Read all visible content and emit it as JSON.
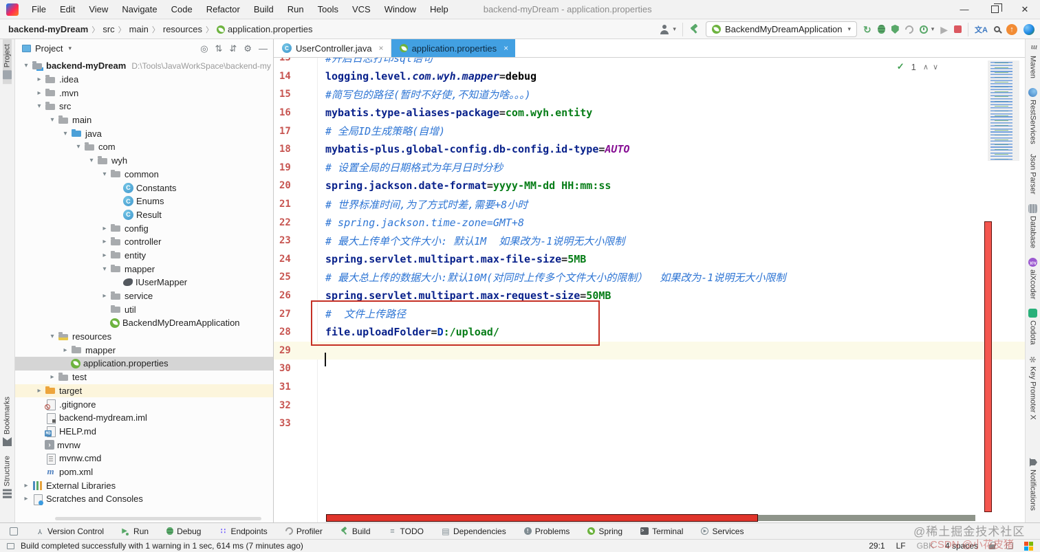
{
  "colors": {
    "accent_blue": "#42A0E2",
    "annotation_red": "#E0342B",
    "key_navy": "#08218B",
    "value_green": "#067D17",
    "comment_blue": "#2E75D4",
    "line_number_red": "#C75450",
    "spring_green": "#6DB33F"
  },
  "window": {
    "title": "backend-myDream - application.properties",
    "controls": {
      "minimize": "—",
      "close": "✕"
    }
  },
  "menu": {
    "items": [
      "File",
      "Edit",
      "View",
      "Navigate",
      "Code",
      "Refactor",
      "Build",
      "Run",
      "Tools",
      "VCS",
      "Window",
      "Help"
    ]
  },
  "toolbar": {
    "breadcrumbs": [
      {
        "t": "backend-myDream",
        "bold": true
      },
      {
        "t": "src"
      },
      {
        "t": "main"
      },
      {
        "t": "resources"
      },
      {
        "t": "application.properties",
        "icon": "spring-leaf"
      }
    ],
    "run_config": "BackendMyDreamApplication"
  },
  "left_stripe": [
    {
      "t": "Project",
      "ic": "si-project",
      "active": true,
      "pos": "top"
    },
    {
      "t": "Bookmarks",
      "ic": "si-bookmark",
      "pos": "bottom"
    },
    {
      "t": "Structure",
      "ic": "si-structure",
      "pos": "bottom"
    }
  ],
  "right_stripe": [
    {
      "t": "Maven",
      "ic": "si-maven",
      "txt": "m"
    },
    {
      "t": "RestServices",
      "ic": "si-rest"
    },
    {
      "t": "Json Parser",
      "ic": ""
    },
    {
      "t": "Database",
      "ic": "si-db"
    },
    {
      "t": "aiXcoder",
      "ic": "si-aix",
      "txt": "AiX"
    },
    {
      "t": "Codota",
      "ic": "si-codota"
    },
    {
      "t": "Key Promoter X",
      "ic": "si-kpx",
      "txt": "✻"
    },
    {
      "t": "Notifications",
      "ic": "si-bell",
      "bottom": true
    }
  ],
  "project_panel": {
    "title": "Project",
    "tree": [
      {
        "d": 0,
        "ch": "v",
        "ic": "project",
        "t": "backend-myDream",
        "bold": true,
        "sub": "D:\\Tools\\JavaWorkSpace\\backend-my"
      },
      {
        "d": 1,
        "ch": ">",
        "ic": "folder",
        "t": ".idea"
      },
      {
        "d": 1,
        "ch": ">",
        "ic": "folder",
        "t": ".mvn"
      },
      {
        "d": 1,
        "ch": "v",
        "ic": "folder",
        "t": "src"
      },
      {
        "d": 2,
        "ch": "v",
        "ic": "folder",
        "t": "main"
      },
      {
        "d": 3,
        "ch": "v",
        "ic": "folder-blue",
        "t": "java"
      },
      {
        "d": 4,
        "ch": "v",
        "ic": "package",
        "t": "com"
      },
      {
        "d": 5,
        "ch": "v",
        "ic": "package",
        "t": "wyh"
      },
      {
        "d": 6,
        "ch": "v",
        "ic": "package",
        "t": "common"
      },
      {
        "d": 7,
        "ch": "",
        "ic": "class",
        "t": "Constants"
      },
      {
        "d": 7,
        "ch": "",
        "ic": "class",
        "t": "Enums"
      },
      {
        "d": 7,
        "ch": "",
        "ic": "class",
        "t": "Result"
      },
      {
        "d": 6,
        "ch": ">",
        "ic": "package",
        "t": "config"
      },
      {
        "d": 6,
        "ch": ">",
        "ic": "package",
        "t": "controller"
      },
      {
        "d": 6,
        "ch": ">",
        "ic": "package",
        "t": "entity"
      },
      {
        "d": 6,
        "ch": "v",
        "ic": "package",
        "t": "mapper"
      },
      {
        "d": 7,
        "ch": "",
        "ic": "mybatis",
        "t": "IUserMapper"
      },
      {
        "d": 6,
        "ch": ">",
        "ic": "package",
        "t": "service"
      },
      {
        "d": 6,
        "ch": "",
        "ic": "package",
        "t": "util"
      },
      {
        "d": 6,
        "ch": "",
        "ic": "spring-class",
        "t": "BackendMyDreamApplication"
      },
      {
        "d": 2,
        "ch": "v",
        "ic": "folder-resources",
        "t": "resources"
      },
      {
        "d": 3,
        "ch": ">",
        "ic": "folder",
        "t": "mapper"
      },
      {
        "d": 3,
        "ch": "",
        "ic": "spring-file",
        "t": "application.properties",
        "sel": true
      },
      {
        "d": 2,
        "ch": ">",
        "ic": "folder",
        "t": "test"
      },
      {
        "d": 1,
        "ch": ">",
        "ic": "folder-orange",
        "t": "target",
        "hl": true
      },
      {
        "d": 1,
        "ch": "",
        "ic": "git-file",
        "t": ".gitignore"
      },
      {
        "d": 1,
        "ch": "",
        "ic": "iml-file",
        "t": "backend-mydream.iml"
      },
      {
        "d": 1,
        "ch": "",
        "ic": "md-file",
        "t": "HELP.md"
      },
      {
        "d": 1,
        "ch": "",
        "ic": "sh-file",
        "t": "mvnw"
      },
      {
        "d": 1,
        "ch": "",
        "ic": "cmd-file",
        "t": "mvnw.cmd"
      },
      {
        "d": 1,
        "ch": "",
        "ic": "maven",
        "t": "pom.xml"
      },
      {
        "d": 0,
        "ch": ">",
        "ic": "libraries",
        "t": "External Libraries"
      },
      {
        "d": 0,
        "ch": ">",
        "ic": "scratches",
        "t": "Scratches and Consoles"
      }
    ]
  },
  "editor": {
    "tabs": [
      {
        "label": "UserController.java",
        "icon": "class",
        "active": false,
        "close": "×"
      },
      {
        "label": "application.properties",
        "icon": "spring",
        "active": true,
        "close": "×"
      }
    ],
    "inspection": {
      "count": "1",
      "up": "∧",
      "down": "∨"
    },
    "cursor_line": 29,
    "lines": [
      {
        "num": 13,
        "segs": [
          {
            "t": "#开启日志打印sql语句",
            "s": "c"
          }
        ]
      },
      {
        "num": 14,
        "segs": [
          {
            "t": "logging.level",
            "s": "key"
          },
          {
            "t": ".com.wyh.mapper",
            "s": "ki"
          },
          {
            "t": "=",
            "s": "eq"
          },
          {
            "t": "debug",
            "s": "bd"
          }
        ]
      },
      {
        "num": 15,
        "segs": [
          {
            "t": "#简写包的路径(暂时不好使,不知道为啥。。。)",
            "s": "c"
          }
        ]
      },
      {
        "num": 16,
        "segs": [
          {
            "t": "mybatis.type-aliases-package",
            "s": "key"
          },
          {
            "t": "=",
            "s": "eq"
          },
          {
            "t": "com.wyh.entity",
            "s": "val"
          }
        ]
      },
      {
        "num": 17,
        "segs": [
          {
            "t": "# 全局ID生成策略(自增)",
            "s": "c"
          }
        ]
      },
      {
        "num": 18,
        "segs": [
          {
            "t": "mybatis-plus.global-config.db-config.id-type",
            "s": "key"
          },
          {
            "t": "=",
            "s": "eq"
          },
          {
            "t": "AUTO",
            "s": "pu"
          }
        ]
      },
      {
        "num": 19,
        "segs": [
          {
            "t": "# 设置全局的日期格式为年月日时分秒",
            "s": "c"
          }
        ]
      },
      {
        "num": 20,
        "segs": [
          {
            "t": "spring.jackson.date-format",
            "s": "key"
          },
          {
            "t": "=",
            "s": "eq"
          },
          {
            "t": "yyyy-MM-dd HH:mm:ss",
            "s": "val"
          }
        ]
      },
      {
        "num": 21,
        "segs": [
          {
            "t": "# 世界标准时间,为了方式时差,需要+8小时",
            "s": "c"
          }
        ]
      },
      {
        "num": 22,
        "segs": [
          {
            "t": "# spring.jackson.time-zone=GMT+8",
            "s": "c"
          }
        ]
      },
      {
        "num": 23,
        "segs": [
          {
            "t": "# 最大上传单个文件大小: 默认1M  如果改为-1说明无大小限制",
            "s": "c"
          }
        ]
      },
      {
        "num": 24,
        "segs": [
          {
            "t": "spring.servlet.multipart.max-file-size",
            "s": "key"
          },
          {
            "t": "=",
            "s": "eq"
          },
          {
            "t": "5MB",
            "s": "val"
          }
        ]
      },
      {
        "num": 25,
        "segs": [
          {
            "t": "# 最大总上传的数据大小:默认10M(对同时上传多个文件大小的限制）  如果改为-1说明无大小限制",
            "s": "c"
          }
        ]
      },
      {
        "num": 26,
        "segs": [
          {
            "t": "spring.servlet.multipart.max-request-size",
            "s": "key"
          },
          {
            "t": "=",
            "s": "eq"
          },
          {
            "t": "50MB",
            "s": "val"
          }
        ]
      },
      {
        "num": 27,
        "segs": [
          {
            "t": "#  文件上传路径",
            "s": "c"
          }
        ]
      },
      {
        "num": 28,
        "segs": [
          {
            "t": "file.uploadFolder",
            "s": "key"
          },
          {
            "t": "=",
            "s": "eq"
          },
          {
            "t": "D",
            "s": "vb"
          },
          {
            "t": ":/upload/",
            "s": "val"
          }
        ]
      },
      {
        "num": 29,
        "segs": []
      },
      {
        "num": 30,
        "segs": []
      },
      {
        "num": 31,
        "segs": []
      },
      {
        "num": 32,
        "segs": []
      },
      {
        "num": 33,
        "segs": []
      }
    ]
  },
  "toolwindow_bar": [
    {
      "label": "Version Control",
      "ic": "bi-branch",
      "txt": "Y"
    },
    {
      "label": "Run",
      "ic": "bi-run",
      "txt": "▶"
    },
    {
      "label": "Debug",
      "ic": "bi-debug"
    },
    {
      "label": "Endpoints",
      "ic": "bi-endpoints",
      "txt": "∷"
    },
    {
      "label": "Profiler",
      "ic": "bi-profiler"
    },
    {
      "label": "Build",
      "ic": "bi-hammer"
    },
    {
      "label": "TODO",
      "ic": "bi-todo",
      "txt": "≡"
    },
    {
      "label": "Dependencies",
      "ic": "bi-deps",
      "txt": "▤"
    },
    {
      "label": "Problems",
      "ic": "bi-problems",
      "txt": "!"
    },
    {
      "label": "Spring",
      "ic": "bi-spring"
    },
    {
      "label": "Terminal",
      "ic": "bi-terminal",
      "txt": ">"
    },
    {
      "label": "Services",
      "ic": "bi-services",
      "txt": "▶"
    }
  ],
  "status_bar": {
    "message": "Build completed successfully with 1 warning in 1 sec, 614 ms (7 minutes ago)",
    "items": [
      {
        "t": "29:1"
      },
      {
        "t": "LF"
      },
      {
        "t": "GBK",
        "dim": true
      },
      {
        "t": "4 spaces"
      }
    ]
  },
  "watermarks": {
    "juejin": "@稀土掘金技术社区",
    "csdn": "CSDN @小花皮猪"
  }
}
